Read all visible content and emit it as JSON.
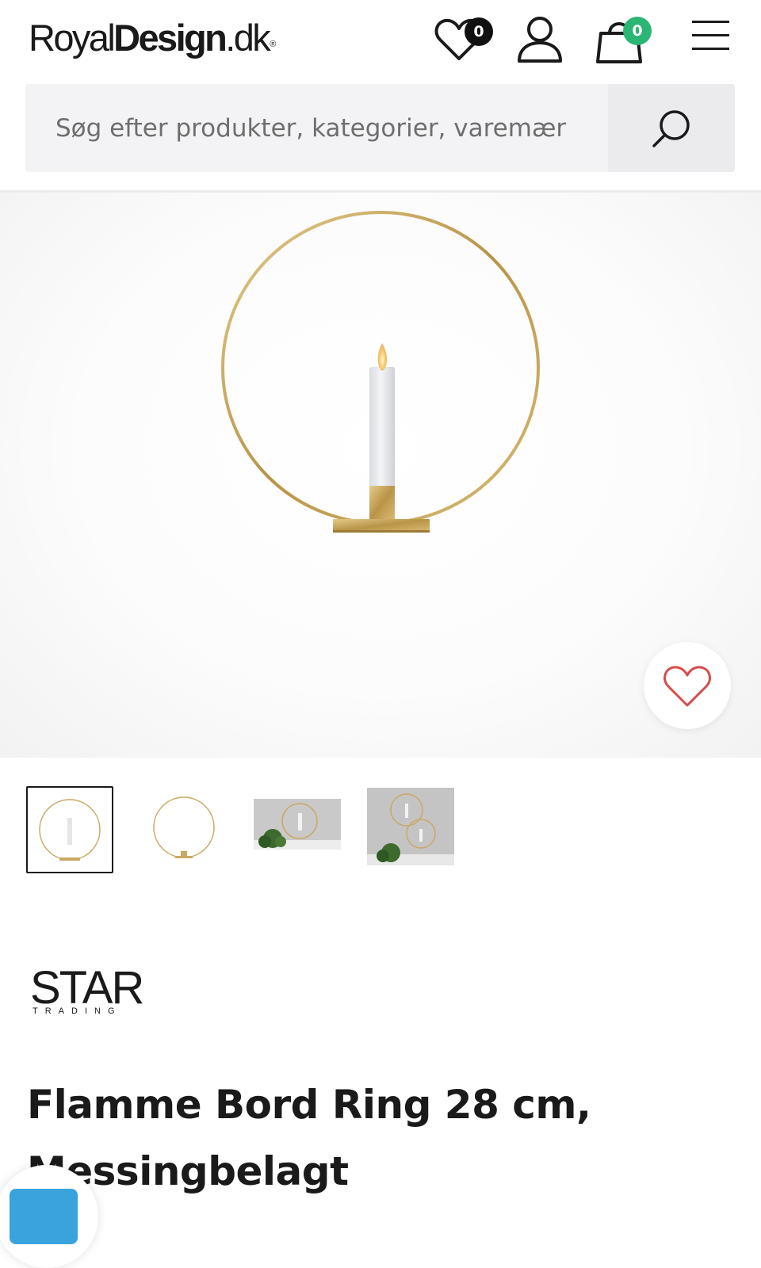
{
  "header": {
    "logo_light": "Royal",
    "logo_bold": "Design",
    "logo_tld": ".dk",
    "logo_reg": "®",
    "wishlist_count": "0",
    "cart_count": "0"
  },
  "search": {
    "placeholder": "Søg efter produkter, kategorier, varemær"
  },
  "product": {
    "brand_name": "STAR",
    "brand_sub": "TRADING",
    "title": "Flamme Bord Ring 28 cm, Messingbelagt"
  },
  "colors": {
    "text": "#1a1a1a",
    "search_bg": "#f3f3f5",
    "cart_badge": "#2bb673",
    "wishlist_badge": "#111111",
    "heart_accent": "#d84a4a",
    "brass": "#c8a860"
  },
  "icons": [
    "heart-icon",
    "user-icon",
    "shopping-bag-icon",
    "menu-icon",
    "search-icon",
    "chat-icon"
  ],
  "thumbnails": {
    "count": 4,
    "active_index": 0
  }
}
